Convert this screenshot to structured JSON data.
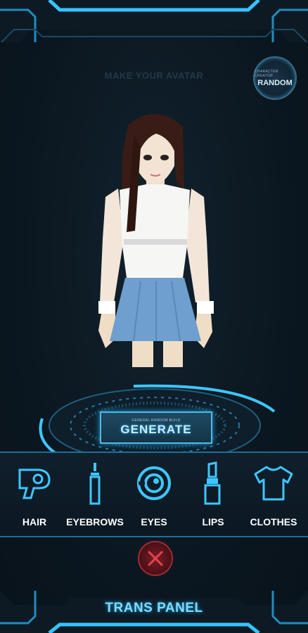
{
  "header": {
    "title": "MAKE YOUR AVATAR"
  },
  "random_button": {
    "small_text": "CHARACTER CREATOR",
    "label": "RANDOM"
  },
  "generate_button": {
    "small_text": "GENERAL RANDOM BUILD",
    "label": "GENERATE"
  },
  "categories": [
    {
      "label": "HAIR",
      "icon": "hair-dryer-icon"
    },
    {
      "label": "EYEBROWS",
      "icon": "eyebrow-pencil-icon"
    },
    {
      "label": "EYES",
      "icon": "eye-icon"
    },
    {
      "label": "LIPS",
      "icon": "lipstick-icon"
    },
    {
      "label": "CLOTHES",
      "icon": "tshirt-icon"
    }
  ],
  "close_button": {
    "icon": "close-icon"
  },
  "footer": {
    "title": "TRANS PANEL"
  },
  "colors": {
    "accent": "#3fc6ff",
    "background": "#0b1720",
    "close": "#a32a34"
  }
}
